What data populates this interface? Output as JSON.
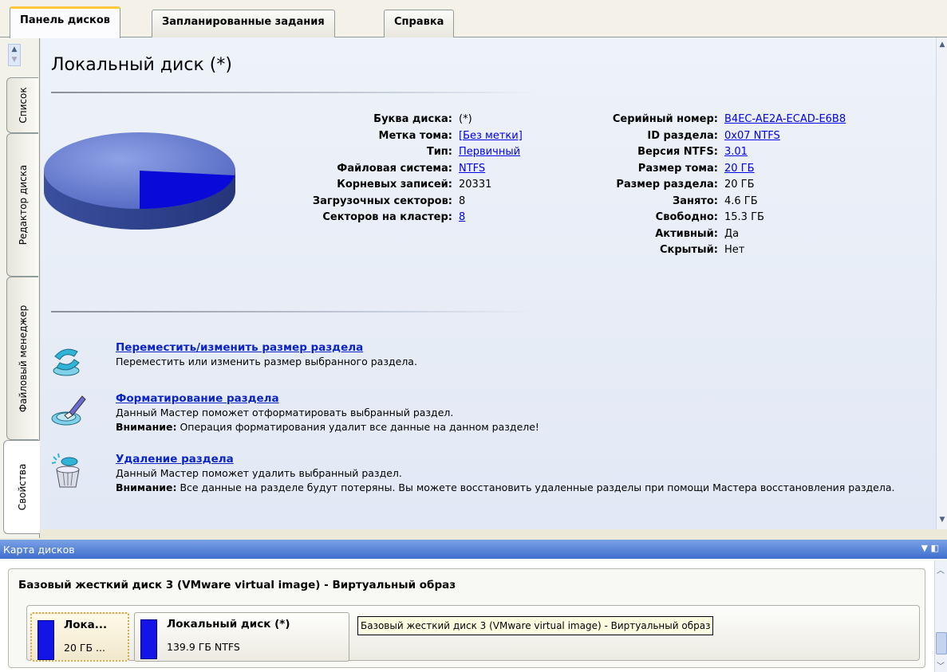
{
  "tabs": [
    "Панель дисков",
    "Запланированные задания",
    "Справка"
  ],
  "side_tabs": [
    "Список",
    "Редактор диска",
    "Файловый менеджер",
    "Свойства"
  ],
  "title": "Локальный диск (*)",
  "props_left": [
    {
      "label": "Буква диска:",
      "value": "(*)",
      "link": false
    },
    {
      "label": "Метка тома:",
      "value": "[Без метки]",
      "link": true
    },
    {
      "label": "Тип:",
      "value": "Первичный",
      "link": true
    },
    {
      "label": "Файловая система:",
      "value": "NTFS",
      "link": true
    },
    {
      "label": "Корневых записей:",
      "value": "20331",
      "link": false
    },
    {
      "label": "Загрузочных секторов:",
      "value": "8",
      "link": false
    },
    {
      "label": "Секторов на кластер:",
      "value": "8",
      "link": true
    }
  ],
  "props_right": [
    {
      "label": "Серийный номер:",
      "value": "B4EC-AE2A-ECAD-E6B8",
      "link": true
    },
    {
      "label": "ID раздела:",
      "value": "0x07 NTFS",
      "link": true
    },
    {
      "label": "Версия NTFS:",
      "value": "3.01",
      "link": true
    },
    {
      "label": "Размер тома:",
      "value": "20 ГБ",
      "link": true
    },
    {
      "label": "Размер раздела:",
      "value": "20 ГБ",
      "link": false
    },
    {
      "label": "Занято:",
      "value": "4.6 ГБ",
      "link": false
    },
    {
      "label": "Свободно:",
      "value": "15.3 ГБ",
      "link": false
    },
    {
      "label": "Активный:",
      "value": "Да",
      "link": false
    },
    {
      "label": "Скрытый:",
      "value": "Нет",
      "link": false
    }
  ],
  "used_fraction": 0.23,
  "colors": {
    "used": "#0a0ad8",
    "free": "#5a72c8",
    "accent": "#ffc83c",
    "map_bar": "#3f6fce"
  },
  "actions": [
    {
      "icon": "resize-partition-icon",
      "title": "Переместить/изменить размер раздела",
      "desc": "Переместить или изменить размер выбранного раздела.",
      "warn_label": "",
      "warn": ""
    },
    {
      "icon": "format-partition-icon",
      "title": "Форматирование раздела",
      "desc": "Данный Мастер поможет отформатировать выбранный раздел.",
      "warn_label": "Внимание:",
      "warn": "Операция форматирования удалит все данные на данном разделе!"
    },
    {
      "icon": "delete-partition-icon",
      "title": "Удаление раздела",
      "desc": "Данный Мастер поможет удалить выбранный раздел.",
      "warn_label": "Внимание:",
      "warn": "Все данные на разделе будут потеряны. Вы можете восстановить удаленные разделы при помощи Мастера восстановления раздела."
    }
  ],
  "map": {
    "title": "Карта дисков",
    "disk_title": "Базовый жесткий диск 3 (VMware virtual image) - Виртуальный образ",
    "partitions": [
      {
        "name": "Лока...",
        "info": "20 ГБ ..."
      },
      {
        "name": "Локальный диск (*)",
        "info": "139.9 ГБ NTFS"
      }
    ],
    "tooltip": "Базовый жесткий диск 3 (VMware virtual image) - Виртуальный образ"
  }
}
